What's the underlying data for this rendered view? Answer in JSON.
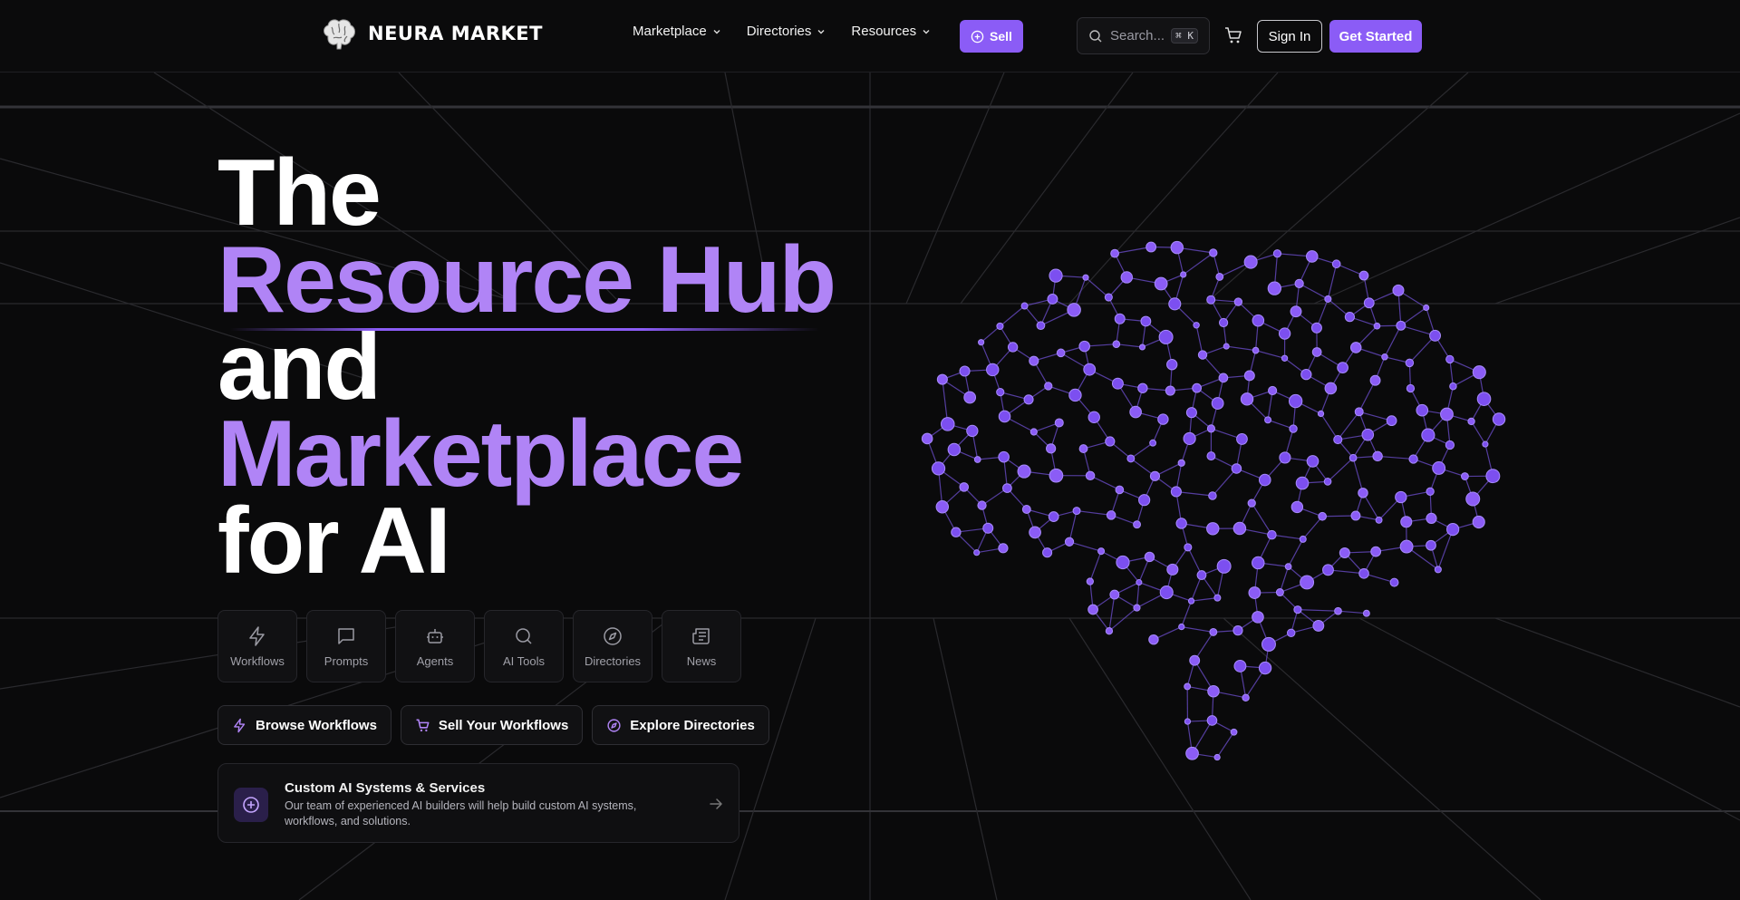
{
  "brand": {
    "name": "NEURA MARKET",
    "logo_icon": "brain-icon"
  },
  "nav": {
    "links": [
      {
        "label": "Marketplace",
        "icon": "chevron-down-icon"
      },
      {
        "label": "Directories",
        "icon": "chevron-down-icon"
      },
      {
        "label": "Resources",
        "icon": "chevron-down-icon"
      }
    ],
    "sell_label": "Sell",
    "search_placeholder": "Search...",
    "search_shortcut": "⌘ K",
    "sign_in_label": "Sign In",
    "get_started_label": "Get Started"
  },
  "hero": {
    "line1": "The",
    "line2": "Resource Hub",
    "line3": "and",
    "line4": "Marketplace",
    "line5": "for AI"
  },
  "categories": [
    {
      "label": "Workflows",
      "icon": "lightning-icon"
    },
    {
      "label": "Prompts",
      "icon": "message-square-icon"
    },
    {
      "label": "Agents",
      "icon": "bot-icon"
    },
    {
      "label": "AI Tools",
      "icon": "search-icon"
    },
    {
      "label": "Directories",
      "icon": "compass-icon"
    },
    {
      "label": "News",
      "icon": "newspaper-icon"
    }
  ],
  "actions": [
    {
      "label": "Browse Workflows",
      "icon": "lightning-icon"
    },
    {
      "label": "Sell Your Workflows",
      "icon": "cart-icon"
    },
    {
      "label": "Explore Directories",
      "icon": "compass-icon"
    }
  ],
  "custom_card": {
    "title": "Custom AI Systems & Services",
    "description": "Our team of experienced AI builders will help build custom AI systems, workflows, and solutions.",
    "icon": "plus-circle-icon",
    "arrow_icon": "arrow-right-icon"
  },
  "colors": {
    "accent": "#8b5cf6",
    "accent_light": "#b084f6",
    "background": "#0a0a0b"
  }
}
